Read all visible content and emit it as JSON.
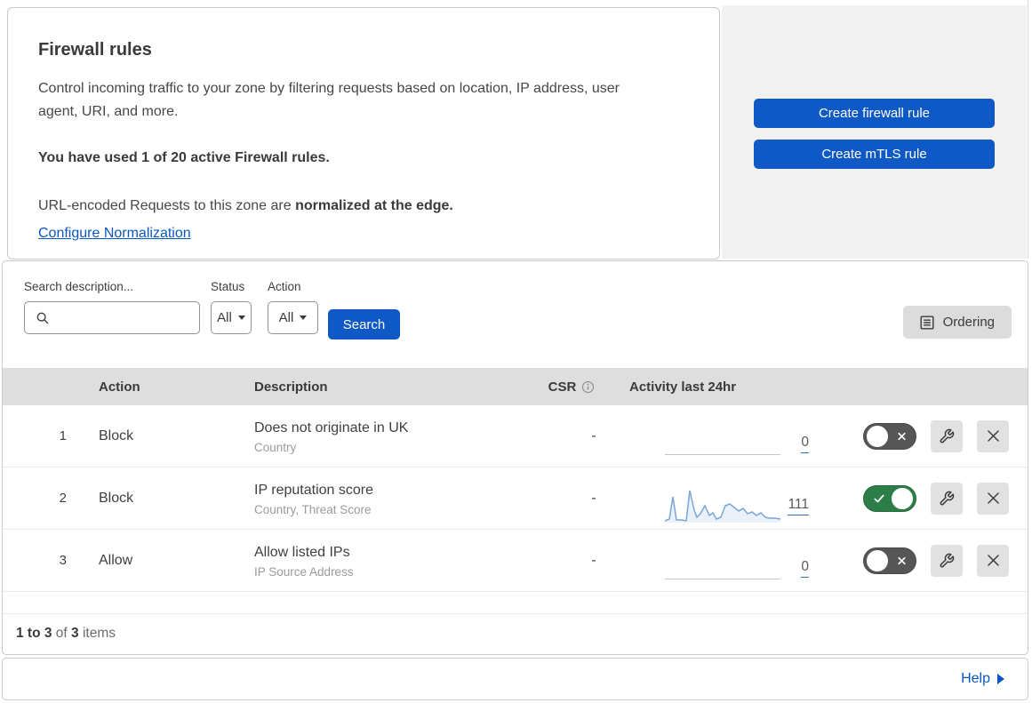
{
  "header": {
    "title": "Firewall rules",
    "description": "Control incoming traffic to your zone by filtering requests based on location, IP address, user agent, URI, and more.",
    "usage": "You have used 1 of 20 active Firewall rules.",
    "normalization_prefix": "URL-encoded Requests to this zone are ",
    "normalization_bold": "normalized at the edge.",
    "normalization_link": "Configure Normalization",
    "buttons": [
      {
        "label": "Create firewall rule"
      },
      {
        "label": "Create mTLS rule"
      }
    ]
  },
  "filters": {
    "search_label": "Search description...",
    "search_value": "",
    "status_label": "Status",
    "status_value": "All",
    "action_label": "Action",
    "action_value": "All",
    "search_button_label": "Search",
    "ordering_button_label": "Ordering"
  },
  "table": {
    "headers": {
      "action": "Action",
      "description": "Description",
      "csr": "CSR",
      "activity": "Activity last 24hr"
    },
    "rows": [
      {
        "priority": "1",
        "action": "Block",
        "description": "Does not originate in UK",
        "fields": "Country",
        "csr": "-",
        "activity_count": "0",
        "enabled": false
      },
      {
        "priority": "2",
        "action": "Block",
        "description": "IP reputation score",
        "fields": "Country, Threat Score",
        "csr": "-",
        "activity_count": "111",
        "enabled": true,
        "sparkline": [
          [
            0,
            40
          ],
          [
            5,
            38
          ],
          [
            9,
            13
          ],
          [
            13,
            39
          ],
          [
            19,
            39
          ],
          [
            24,
            40
          ],
          [
            28,
            6
          ],
          [
            33,
            28
          ],
          [
            36,
            36
          ],
          [
            40,
            32
          ],
          [
            45,
            23
          ],
          [
            50,
            34
          ],
          [
            54,
            31
          ],
          [
            58,
            38
          ],
          [
            63,
            36
          ],
          [
            68,
            23
          ],
          [
            73,
            21
          ],
          [
            78,
            25
          ],
          [
            83,
            29
          ],
          [
            88,
            26
          ],
          [
            93,
            32
          ],
          [
            98,
            30
          ],
          [
            103,
            34
          ],
          [
            108,
            31
          ],
          [
            113,
            36
          ],
          [
            118,
            37
          ],
          [
            124,
            37
          ],
          [
            130,
            38
          ]
        ]
      },
      {
        "priority": "3",
        "action": "Allow",
        "description": "Allow listed IPs",
        "fields": "IP Source Address",
        "csr": "-",
        "activity_count": "0",
        "enabled": false
      }
    ],
    "footer": {
      "range": "1 to 3",
      "of": "of",
      "total": "3",
      "items": "items"
    }
  },
  "help": {
    "label": "Help"
  },
  "colors": {
    "accent_blue": "#0f59c6",
    "link_blue": "#0b57c2",
    "toggle_on_green": "#2c7e46",
    "toggle_off_gray": "#565656",
    "sparkline_blue": "#7aa5d8",
    "table_header_gray": "#dedede",
    "panel_gray": "#f1f1f2"
  }
}
